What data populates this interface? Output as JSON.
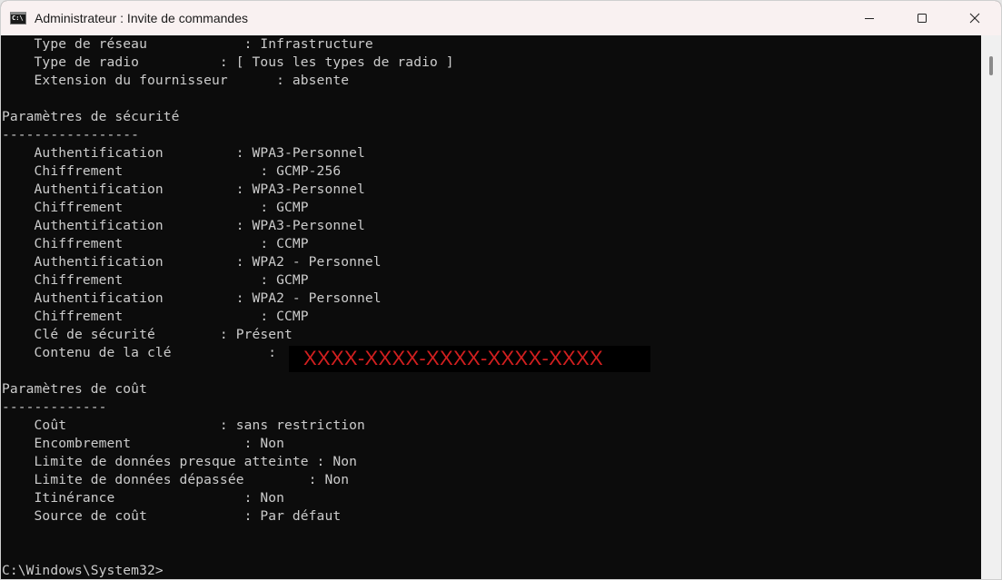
{
  "window": {
    "title": "Administrateur : Invite de commandes",
    "icon": "cmd-icon",
    "controls": {
      "minimize": "minimize-icon",
      "maximize": "maximize-icon",
      "close": "close-icon"
    }
  },
  "console": {
    "lines": [
      "    Type de réseau            : Infrastructure",
      "    Type de radio          : [ Tous les types de radio ]",
      "    Extension du fournisseur      : absente",
      "",
      "Paramètres de sécurité",
      "-----------------",
      "    Authentification         : WPA3-Personnel",
      "    Chiffrement                 : GCMP-256",
      "    Authentification         : WPA3-Personnel",
      "    Chiffrement                 : GCMP",
      "    Authentification         : WPA3-Personnel",
      "    Chiffrement                 : CCMP",
      "    Authentification         : WPA2 - Personnel",
      "    Chiffrement                 : GCMP",
      "    Authentification         : WPA2 - Personnel",
      "    Chiffrement                 : CCMP",
      "    Clé de sécurité        : Présent",
      "    Contenu de la clé            : ",
      "",
      "Paramètres de coût",
      "-------------",
      "    Coût                   : sans restriction",
      "    Encombrement              : Non",
      "    Limite de données presque atteinte : Non",
      "    Limite de données dépassée        : Non",
      "    Itinérance                : Non",
      "    Source de coût            : Par défaut",
      "",
      "",
      "C:\\Windows\\System32>"
    ],
    "redacted_key": "XXXX-XXXX-XXXX-XXXX-XXXX",
    "redaction_color": "#d21f1f"
  },
  "scrollbar": {
    "position": "top"
  }
}
